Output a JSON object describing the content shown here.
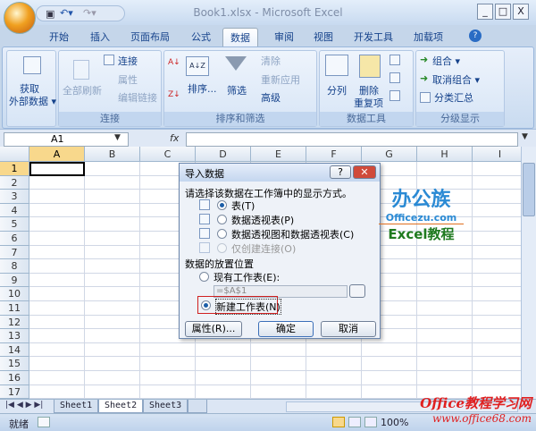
{
  "window": {
    "title": "Book1.xlsx - Microsoft Excel",
    "minimize": "_",
    "maximize": "□",
    "close": "X"
  },
  "tabs": [
    "开始",
    "插入",
    "页面布局",
    "公式",
    "数据",
    "审阅",
    "视图",
    "开发工具",
    "加载项"
  ],
  "active_tab": "数据",
  "ribbon": {
    "get_external": "获取\n外部数据",
    "get_external_l1": "获取",
    "get_external_l2": "外部数据 ▾",
    "refresh_all": "全部刷新",
    "connections": "连接",
    "properties": "属性",
    "edit_links": "编辑链接",
    "group_conn": "连接",
    "sort_az": "A↓Z",
    "sort": "排序...",
    "filter": "筛选",
    "clear": "清除",
    "reapply": "重新应用",
    "advanced": "高级",
    "group_sort": "排序和筛选",
    "text_to_columns": "分列",
    "remove_dup_l1": "删除",
    "remove_dup_l2": "重复项",
    "group_tools": "数据工具",
    "group": "组合 ▾",
    "ungroup": "取消组合 ▾",
    "subtotal": "分类汇总",
    "group_outline": "分级显示"
  },
  "formula_bar": {
    "name_box": "A1",
    "fx": "fx",
    "value": ""
  },
  "columns": [
    "A",
    "B",
    "C",
    "D",
    "E",
    "F",
    "G",
    "H",
    "I"
  ],
  "rows": [
    "1",
    "2",
    "3",
    "4",
    "5",
    "6",
    "7",
    "8",
    "9",
    "10",
    "11",
    "12",
    "13",
    "14",
    "15",
    "16",
    "17"
  ],
  "dialog": {
    "title": "导入数据",
    "help": "?",
    "close": "✕",
    "prompt": "请选择该数据在工作簿中的显示方式。",
    "view_options": [
      {
        "label": "表(T)",
        "selected": true,
        "enabled": true
      },
      {
        "label": "数据透视表(P)",
        "selected": false,
        "enabled": true
      },
      {
        "label": "数据透视图和数据透视表(C)",
        "selected": false,
        "enabled": true
      },
      {
        "label": "仅创建连接(O)",
        "selected": false,
        "enabled": false
      }
    ],
    "location_label": "数据的放置位置",
    "existing_sheet": "现有工作表(E):",
    "existing_ref": "=$A$1",
    "new_sheet": "新建工作表(N)",
    "properties_btn": "属性(R)...",
    "ok_btn": "确定",
    "cancel_btn": "取消"
  },
  "watermark": {
    "logo_cn": "办公族",
    "logo_site": "Officezu.com",
    "logo_sub": "Excel教程",
    "bottom_site": "Office教程学习网",
    "bottom_url": "www.office68.com"
  },
  "sheets": [
    "Sheet1",
    "Sheet2",
    "Sheet3"
  ],
  "active_sheet": "Sheet2",
  "status": {
    "ready": "就绪",
    "zoom": "100%"
  },
  "colors": {
    "accent": "#15428b",
    "highlight": "#d02020"
  }
}
